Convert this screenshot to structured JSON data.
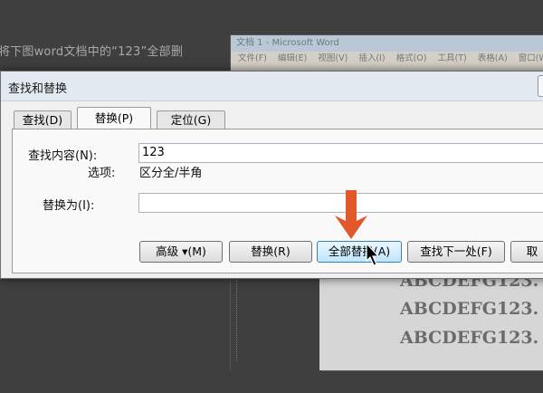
{
  "instruction": "将下图word文档中的“123”全部删",
  "word": {
    "title": "文档 1 - Microsoft Word",
    "menu": [
      "文件(F)",
      "编辑(E)",
      "视图(V)",
      "插入(I)",
      "格式(O)",
      "工具(T)",
      "表格(A)",
      "窗口(W)"
    ],
    "doc_lines": [
      "ABCDEFG123.",
      "ABCDEFG123.",
      "ABCDEFG123."
    ]
  },
  "dialog": {
    "title": "查找和替换",
    "tabs": [
      {
        "label": "查找(D)"
      },
      {
        "label": "替换(P)"
      },
      {
        "label": "定位(G)"
      }
    ],
    "find_label": "查找内容(N):",
    "find_value": "123",
    "options_label": "选项:",
    "options_value": "区分全/半角",
    "replace_label": "替换为(I):",
    "replace_value": "",
    "buttons": {
      "more": "高级 ▾(M)",
      "replace": "替换(R)",
      "replace_all": "全部替换(A)",
      "find_next": "查找下一处(F)",
      "cancel": "取"
    }
  },
  "colors": {
    "arrow": "#e2582a",
    "hot_button": "#bee6fd"
  }
}
